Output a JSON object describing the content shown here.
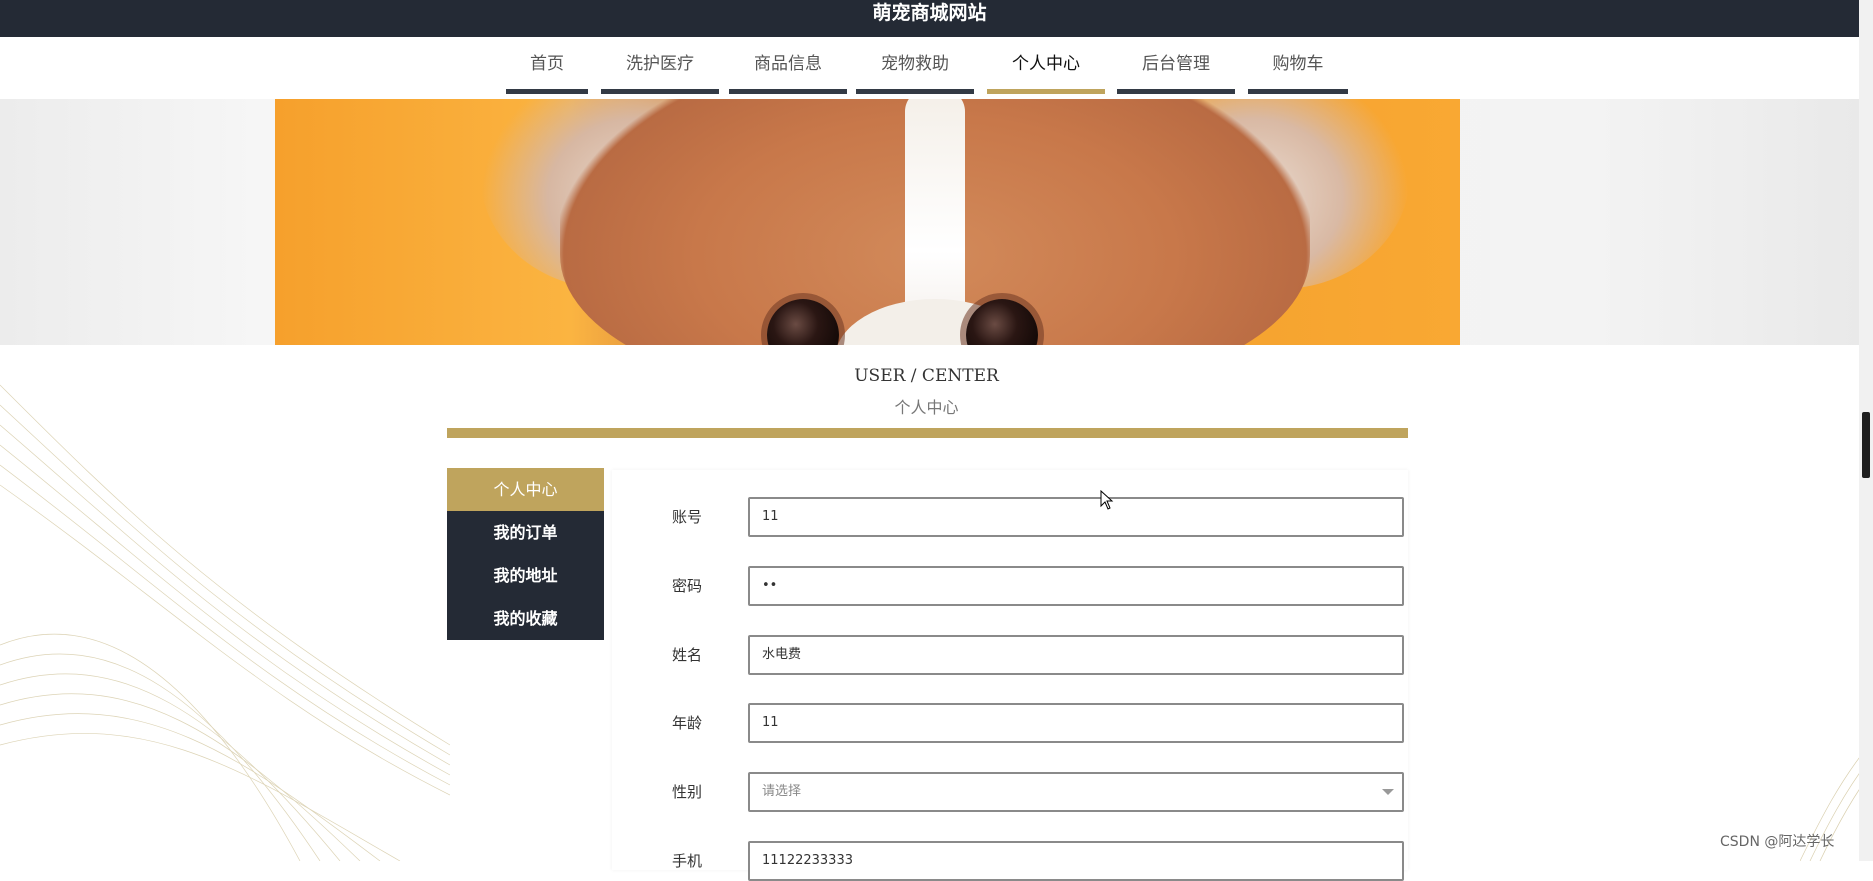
{
  "site": {
    "title": "萌宠商城网站"
  },
  "nav": {
    "items": [
      {
        "label": "首页"
      },
      {
        "label": "洗护医疗"
      },
      {
        "label": "商品信息"
      },
      {
        "label": "宠物救助"
      },
      {
        "label": "个人中心",
        "active": true
      },
      {
        "label": "后台管理"
      },
      {
        "label": "购物车"
      }
    ]
  },
  "section": {
    "title_en": "USER / CENTER",
    "title_cn": "个人中心"
  },
  "sidebar": {
    "items": [
      {
        "label": "个人中心",
        "active": true
      },
      {
        "label": "我的订单"
      },
      {
        "label": "我的地址"
      },
      {
        "label": "我的收藏"
      }
    ]
  },
  "form": {
    "account": {
      "label": "账号",
      "value": "11"
    },
    "password": {
      "label": "密码",
      "value": "••"
    },
    "name": {
      "label": "姓名",
      "value": "水电费"
    },
    "age": {
      "label": "年龄",
      "value": "11"
    },
    "gender": {
      "label": "性别",
      "placeholder": "请选择"
    },
    "phone": {
      "label": "手机",
      "value": "11122233333"
    }
  },
  "watermark": "CSDN @阿达学长",
  "colors": {
    "accent": "#bfa45d",
    "dark": "#242a35"
  }
}
